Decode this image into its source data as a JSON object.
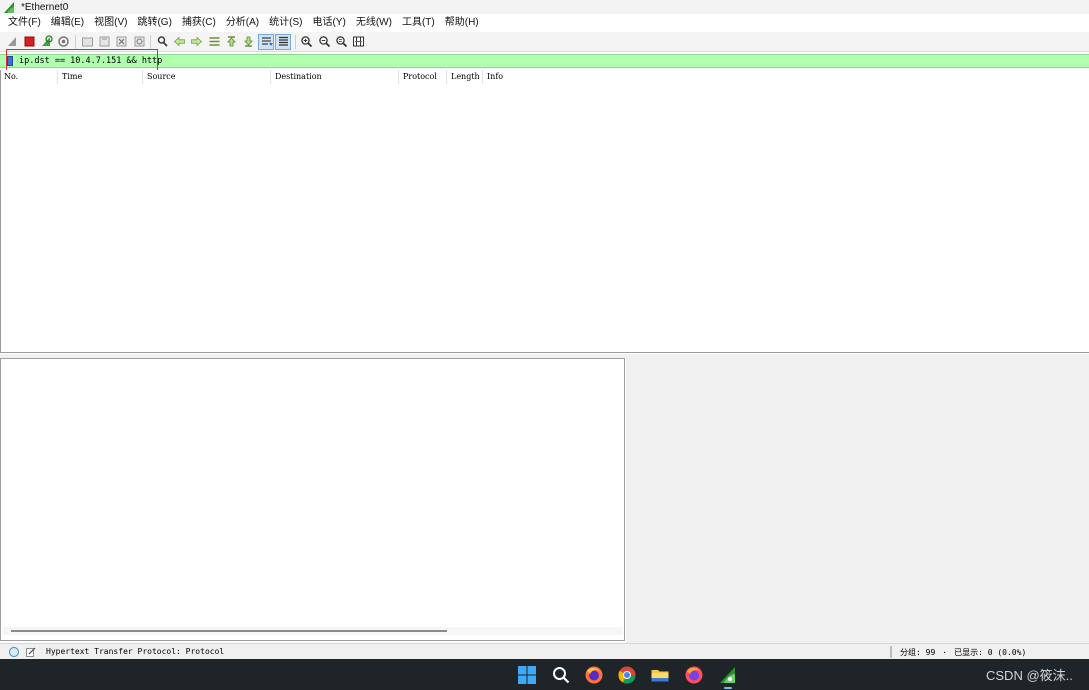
{
  "window": {
    "title": "*Ethernet0"
  },
  "menu": {
    "items": [
      "文件(F)",
      "编辑(E)",
      "视图(V)",
      "跳转(G)",
      "捕获(C)",
      "分析(A)",
      "统计(S)",
      "电话(Y)",
      "无线(W)",
      "工具(T)",
      "帮助(H)"
    ]
  },
  "toolbar": {
    "icons": [
      "start-capture-icon",
      "stop-capture-icon",
      "restart-capture-icon",
      "capture-options-icon",
      "open-file-icon",
      "save-file-icon",
      "close-file-icon",
      "reload-file-icon",
      "find-packet-icon",
      "go-back-icon",
      "go-forward-icon",
      "go-to-packet-icon",
      "go-first-icon",
      "go-last-icon",
      "autoscroll-icon",
      "colorize-icon",
      "zoom-in-icon",
      "zoom-out-icon",
      "zoom-normal-icon",
      "resize-columns-icon"
    ]
  },
  "filter": {
    "value": "ip.dst == 10.4.7.151 && http"
  },
  "packet_list": {
    "columns": [
      "No.",
      "Time",
      "Source",
      "Destination",
      "Protocol",
      "Length",
      "Info"
    ]
  },
  "status": {
    "left_text": "Hypertext Transfer Protocol: Protocol",
    "packets": "分组: 99",
    "separator": "·",
    "displayed": "已显示: 0 (0.0%)"
  },
  "taskbar": {
    "watermark": "CSDN @筱沫.."
  },
  "colors": {
    "filter_valid_bg": "#afffaf",
    "highlight_box": "#e22b2b",
    "taskbar_bg": "#1f2428"
  }
}
